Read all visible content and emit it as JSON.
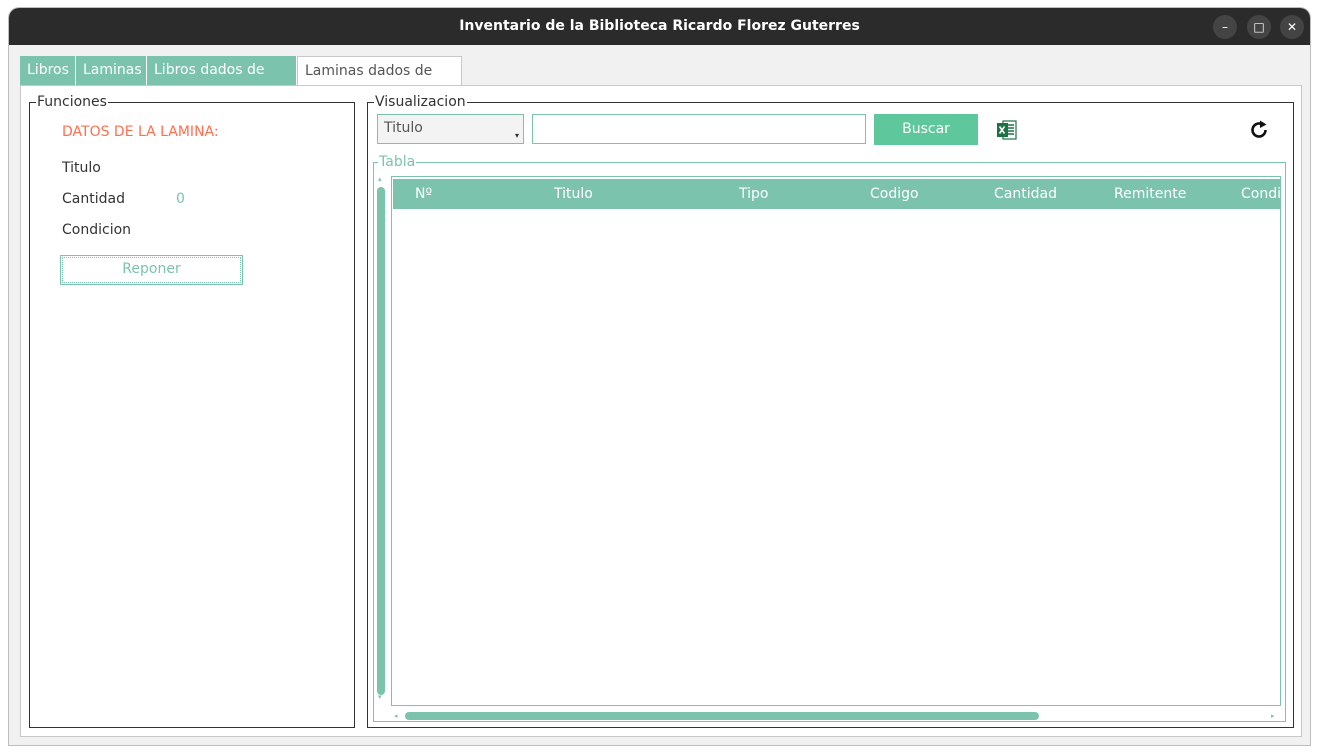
{
  "window": {
    "title": "Inventario de la Biblioteca Ricardo Florez Guterres",
    "minimize_glyph": "–",
    "maximize_glyph": "□",
    "close_glyph": "✕"
  },
  "tabs": [
    {
      "label": "Libros"
    },
    {
      "label": "Laminas"
    },
    {
      "label": "Libros dados de baja"
    },
    {
      "label": "Laminas dados de baja"
    }
  ],
  "funciones": {
    "legend": "Funciones",
    "heading": "DATOS DE LA LAMINA:",
    "titulo_label": "Titulo",
    "cantidad_label": "Cantidad",
    "cantidad_value": "0",
    "condicion_label": "Condicion",
    "reponer_button": "Reponer"
  },
  "visualizacion": {
    "legend": "Visualizacion",
    "filter_selected": "Titulo",
    "search_value": "",
    "buscar_button": "Buscar",
    "excel_icon": "excel-icon",
    "refresh_icon": "refresh-icon"
  },
  "tabla": {
    "legend": "Tabla",
    "columns": [
      "Nº",
      "Titulo",
      "Tipo",
      "Codigo",
      "Cantidad",
      "Remitente",
      "Condic"
    ],
    "rows": []
  },
  "colors": {
    "accent": "#7cc3ad",
    "button_green": "#5fc79c",
    "heading_orange": "#ff6f4e",
    "titlebar": "#2b2b2b"
  }
}
